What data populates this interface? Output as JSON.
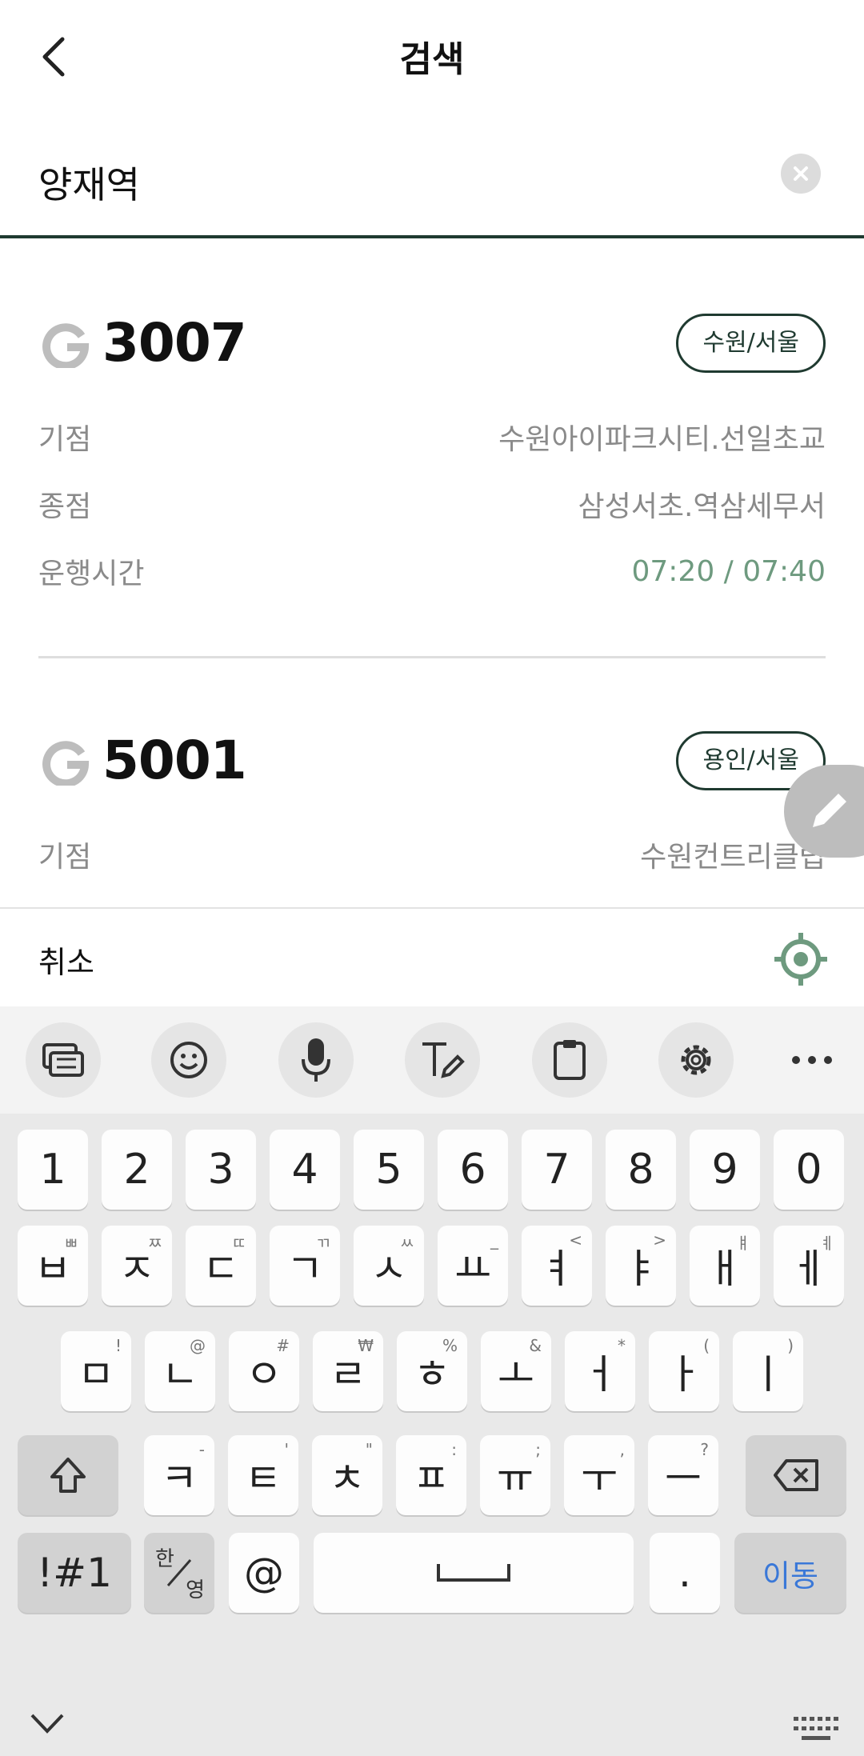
{
  "header": {
    "title": "검색",
    "back_icon": "chevron-left-icon"
  },
  "search": {
    "value": "양재역",
    "placeholder": "",
    "clear_icon": "close-circle-icon"
  },
  "routes": [
    {
      "number": "3007",
      "region": "수원/서울",
      "rows": [
        {
          "label": "기점",
          "value": "수원아이파크시티.선일초교"
        },
        {
          "label": "종점",
          "value": "삼성서초.역삼세무서"
        },
        {
          "label": "운행시간",
          "value": "07:20 / 07:40"
        }
      ]
    },
    {
      "number": "5001",
      "region": "용인/서울",
      "rows": [
        {
          "label": "기점",
          "value": "수원컨트리클럽"
        }
      ]
    }
  ],
  "cancel_bar": {
    "cancel_label": "취소",
    "locate_icon": "my-location-icon"
  },
  "colors": {
    "accent_dark": "#1f3a30",
    "time_green": "#6e9a7f",
    "enter_blue": "#3a78d8"
  },
  "keyboard": {
    "toolbar": [
      "keyboard-icon",
      "emoji-icon",
      "mic-icon",
      "handwriting-icon",
      "clipboard-icon",
      "gear-icon",
      "more-icon"
    ],
    "numbers": [
      "1",
      "2",
      "3",
      "4",
      "5",
      "6",
      "7",
      "8",
      "9",
      "0"
    ],
    "row1": [
      {
        "k": "ㅂ",
        "s": "ㅃ"
      },
      {
        "k": "ㅈ",
        "s": "ㅉ"
      },
      {
        "k": "ㄷ",
        "s": "ㄸ"
      },
      {
        "k": "ㄱ",
        "s": "ㄲ"
      },
      {
        "k": "ㅅ",
        "s": "ㅆ"
      },
      {
        "k": "ㅛ",
        "s": "_"
      },
      {
        "k": "ㅕ",
        "s": "<"
      },
      {
        "k": "ㅑ",
        "s": ">"
      },
      {
        "k": "ㅐ",
        "s": "ㅒ"
      },
      {
        "k": "ㅔ",
        "s": "ㅖ"
      }
    ],
    "row2": [
      {
        "k": "ㅁ",
        "s": "!"
      },
      {
        "k": "ㄴ",
        "s": "@"
      },
      {
        "k": "ㅇ",
        "s": "#"
      },
      {
        "k": "ㄹ",
        "s": "₩"
      },
      {
        "k": "ㅎ",
        "s": "%"
      },
      {
        "k": "ㅗ",
        "s": "&"
      },
      {
        "k": "ㅓ",
        "s": "*"
      },
      {
        "k": "ㅏ",
        "s": "("
      },
      {
        "k": "ㅣ",
        "s": ")"
      }
    ],
    "row3": [
      {
        "k": "ㅋ",
        "s": "-"
      },
      {
        "k": "ㅌ",
        "s": "'"
      },
      {
        "k": "ㅊ",
        "s": "\""
      },
      {
        "k": "ㅍ",
        "s": ":"
      },
      {
        "k": "ㅠ",
        "s": ";"
      },
      {
        "k": "ㅜ",
        "s": ","
      },
      {
        "k": "ㅡ",
        "s": "?"
      }
    ],
    "symbols_label": "!#1",
    "lang_top": "한",
    "lang_bottom": "영",
    "at_label": "@",
    "period_label": ".",
    "enter_label": "이동"
  }
}
